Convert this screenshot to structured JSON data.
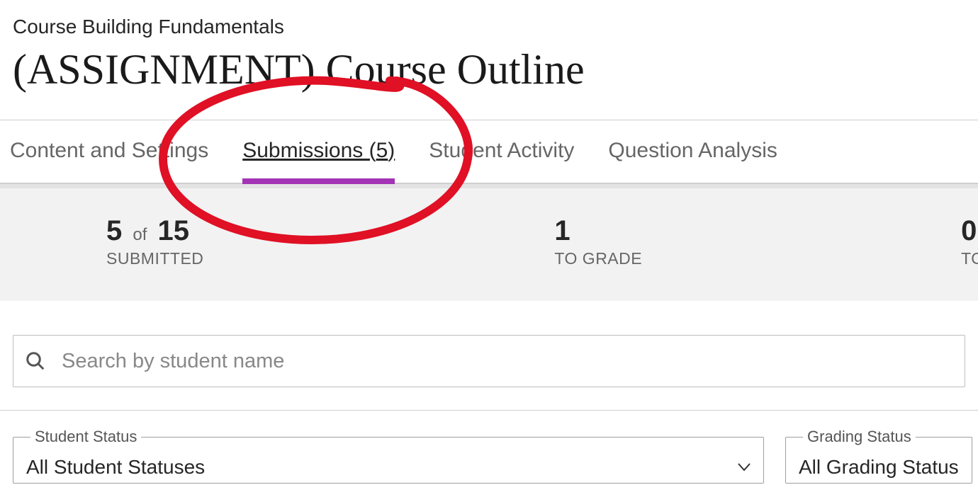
{
  "course_name": "Course Building Fundamentals",
  "page_title": "(ASSIGNMENT) Course Outline",
  "tabs": {
    "content": "Content and Settings",
    "submissions_prefix": "Submissions (",
    "submissions_count": "5",
    "submissions_suffix": ")",
    "student_activity": "Student Activity",
    "question_analysis": "Question Analysis"
  },
  "stats": {
    "submitted_count": "5",
    "submitted_of": "of",
    "submitted_total": "15",
    "submitted_label": "SUBMITTED",
    "to_grade_count": "1",
    "to_grade_label": "TO GRADE",
    "to_post_count": "0",
    "to_post_label": "TO P"
  },
  "search": {
    "placeholder": "Search by student name"
  },
  "filters": {
    "student_status_legend": "Student Status",
    "student_status_value": "All Student Statuses",
    "grading_status_legend": "Grading Status",
    "grading_status_value": "All Grading Status"
  }
}
